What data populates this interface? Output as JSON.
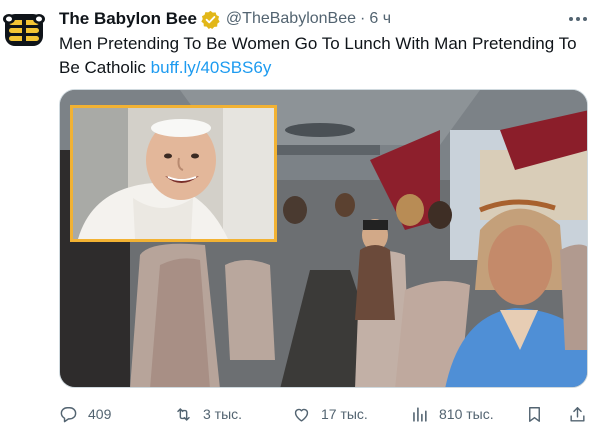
{
  "author": {
    "display_name": "The Babylon Bee",
    "handle": "@TheBabylonBee",
    "separator": "·",
    "time": "6 ч"
  },
  "tweet": {
    "text": "Men Pretending To Be Women Go To Lunch With Man Pretending To Be Catholic",
    "link": "buff.ly/40SBS6y"
  },
  "actions": {
    "replies": "409",
    "retweets": "3 тыс.",
    "likes": "17 тыс.",
    "views": "810 тыс."
  },
  "colors": {
    "text": "#0f1419",
    "muted": "#536471",
    "link": "#1d9bf0",
    "verified_badge": "#e2b719",
    "inset_border": "#f2b233"
  },
  "icons": {
    "avatar": "babylon-bee-logo",
    "verified": "verified-badge-icon",
    "more": "more-icon",
    "reply": "reply-icon",
    "retweet": "retweet-icon",
    "like": "heart-icon",
    "views": "views-icon",
    "bookmark": "bookmark-icon",
    "share": "share-icon"
  }
}
